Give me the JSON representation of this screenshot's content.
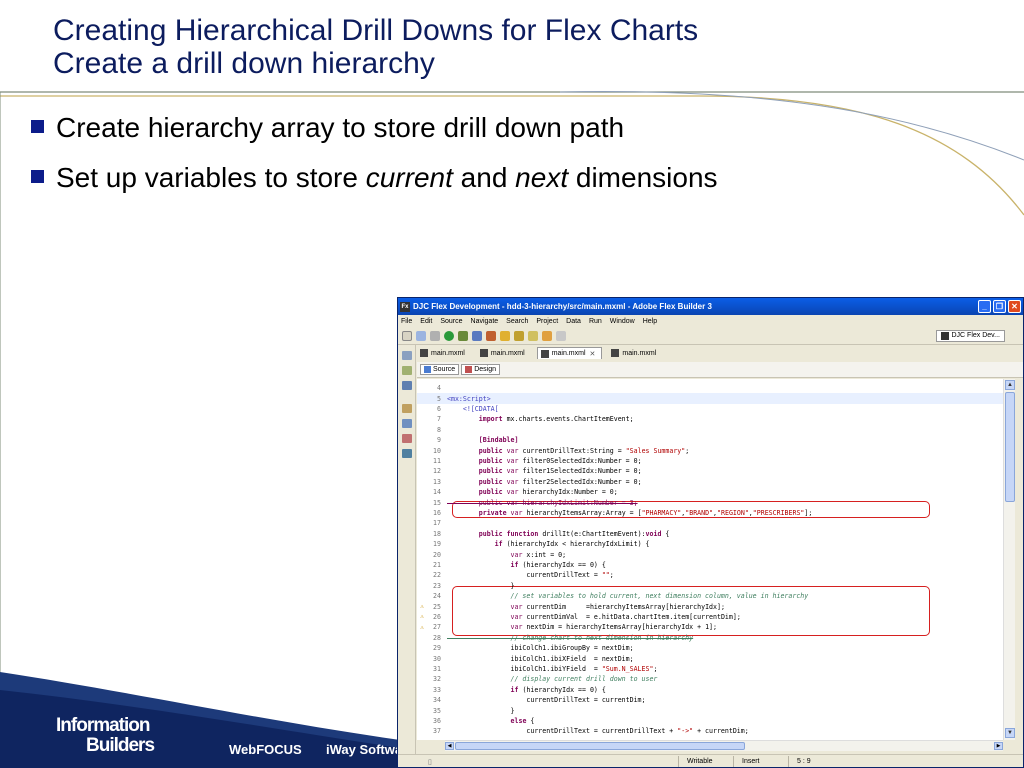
{
  "slide": {
    "title_line1": "Creating Hierarchical Drill Downs for Flex Charts",
    "title_line2": "Create a drill down hierarchy",
    "bullet1": "Create hierarchy array to store drill down path",
    "bullet2_pre": "Set up variables to store ",
    "bullet2_em1": "current",
    "bullet2_mid": " and ",
    "bullet2_em2": "next",
    "bullet2_post": " dimensions",
    "colors": {
      "title": "#0c1c5e",
      "bullet_square": "#0c1c8a",
      "footer_wave": "#1d3a7a"
    }
  },
  "footer": {
    "logo_line1": "Information",
    "logo_line2": "Builders",
    "link1": "WebFOCUS",
    "link2": "iWay Softwa"
  },
  "ide": {
    "window_title": "DJC Flex Development - hdd-3-hierarchy/src/main.mxml - Adobe Flex Builder 3",
    "menu": [
      "File",
      "Edit",
      "Source",
      "Navigate",
      "Search",
      "Project",
      "Data",
      "Run",
      "Window",
      "Help"
    ],
    "perspective": "DJC Flex Dev...",
    "tabs": [
      "main.mxml",
      "main.mxml",
      "main.mxml",
      "main.mxml"
    ],
    "active_tab_index": 2,
    "source_button": "Source",
    "design_button": "Design",
    "code_lines": [
      {
        "n": "4",
        "text": ""
      },
      {
        "n": "5",
        "text": "<mx:Script>"
      },
      {
        "n": "6",
        "text": "    <![CDATA["
      },
      {
        "n": "7",
        "text": "        import mx.charts.events.ChartItemEvent;"
      },
      {
        "n": "8",
        "text": ""
      },
      {
        "n": "9",
        "text": "        [Bindable]"
      },
      {
        "n": "10",
        "text": "        public var currentDrillText:String = \"Sales Summary\";"
      },
      {
        "n": "11",
        "text": "        public var filter0SelectedIdx:Number = 0;"
      },
      {
        "n": "12",
        "text": "        public var filter1SelectedIdx:Number = 0;"
      },
      {
        "n": "13",
        "text": "        public var filter2SelectedIdx:Number = 0;"
      },
      {
        "n": "14",
        "text": "        public var hierarchyIdx:Number = 0;"
      },
      {
        "n": "15",
        "text": "        public var hierarchyIdxLimit:Number = 3;"
      },
      {
        "n": "16",
        "text": "        private var hierarchyItemsArray:Array = [\"PHARMACY\",\"BRAND\",\"REGION\",\"PRESCRIBERS\"];"
      },
      {
        "n": "17",
        "text": ""
      },
      {
        "n": "18",
        "text": "        public function drillIt(e:ChartItemEvent):void {"
      },
      {
        "n": "19",
        "text": "            if (hierarchyIdx < hierarchyIdxLimit) {"
      },
      {
        "n": "20",
        "text": "                var x:int = 0;"
      },
      {
        "n": "21",
        "text": "                if (hierarchyIdx == 0) {"
      },
      {
        "n": "22",
        "text": "                    currentDrillText = \"\";"
      },
      {
        "n": "23",
        "text": "                }"
      },
      {
        "n": "24",
        "text": "                // set variables to hold current, next dimension column, value in hierarchy"
      },
      {
        "n": "25",
        "text": "                var currentDim     =hierarchyItemsArray[hierarchyIdx];"
      },
      {
        "n": "26",
        "text": "                var currentDimVal  = e.hitData.chartItem.item[currentDim];"
      },
      {
        "n": "27",
        "text": "                var nextDim = hierarchyItemsArray[hierarchyIdx + 1];"
      },
      {
        "n": "28",
        "text": "                // change chart to next dimension in hierarchy"
      },
      {
        "n": "29",
        "text": "                ibiColCh1.ibiGroupBy = nextDim;"
      },
      {
        "n": "30",
        "text": "                ibiColCh1.ibiXField  = nextDim;"
      },
      {
        "n": "31",
        "text": "                ibiColCh1.ibiYField  = \"Sum.N_SALES\";"
      },
      {
        "n": "32",
        "text": "                // display current drill down to user"
      },
      {
        "n": "33",
        "text": "                if (hierarchyIdx == 0) {"
      },
      {
        "n": "34",
        "text": "                    currentDrillText = currentDim;"
      },
      {
        "n": "35",
        "text": "                }"
      },
      {
        "n": "36",
        "text": "                else {"
      },
      {
        "n": "37",
        "text": "                    currentDrillText = currentDrillText + \"->\" + currentDim;"
      }
    ],
    "status": {
      "mode": "Writable",
      "insert": "Insert",
      "position": "5 : 9"
    }
  }
}
